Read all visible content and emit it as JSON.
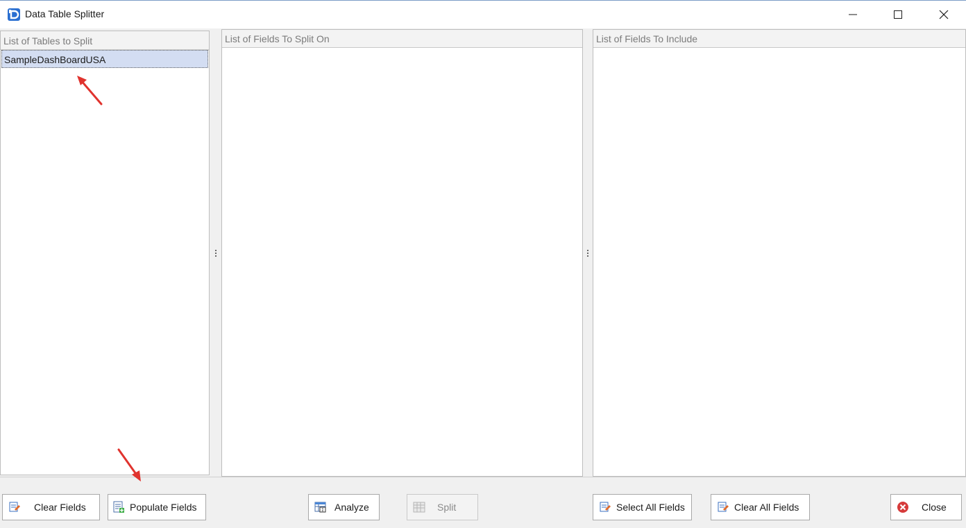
{
  "window": {
    "title": "Data Table Splitter"
  },
  "panels": {
    "tables": {
      "header": "List of Tables to Split",
      "items": [
        "SampleDashBoardUSA"
      ],
      "selected_index": 0
    },
    "split_fields": {
      "header": "List of Fields To Split On",
      "items": []
    },
    "include_fields": {
      "header": "List of Fields To Include",
      "items": []
    }
  },
  "buttons": {
    "clear_fields": "Clear Fields",
    "populate_fields": "Populate Fields",
    "analyze": "Analyze",
    "split": "Split",
    "select_all_fields": "Select All Fields",
    "clear_all_fields": "Clear All Fields",
    "close": "Close"
  },
  "states": {
    "split_enabled": false
  },
  "colors": {
    "selection": "#d3ddf2",
    "annotation_arrow": "#e0332e",
    "app_icon": "#2a6fd1",
    "close_icon": "#d63b3b"
  },
  "icons": {
    "app": "app-logo-icon",
    "minimize": "minimize-icon",
    "maximize": "maximize-icon",
    "close_window": "close-icon",
    "clear_fields": "clear-fields-icon",
    "populate_fields": "populate-fields-icon",
    "analyze": "analyze-table-icon",
    "split": "split-table-icon",
    "select_all": "select-all-icon",
    "clear_all": "clear-all-icon",
    "close_button": "close-circle-icon"
  }
}
